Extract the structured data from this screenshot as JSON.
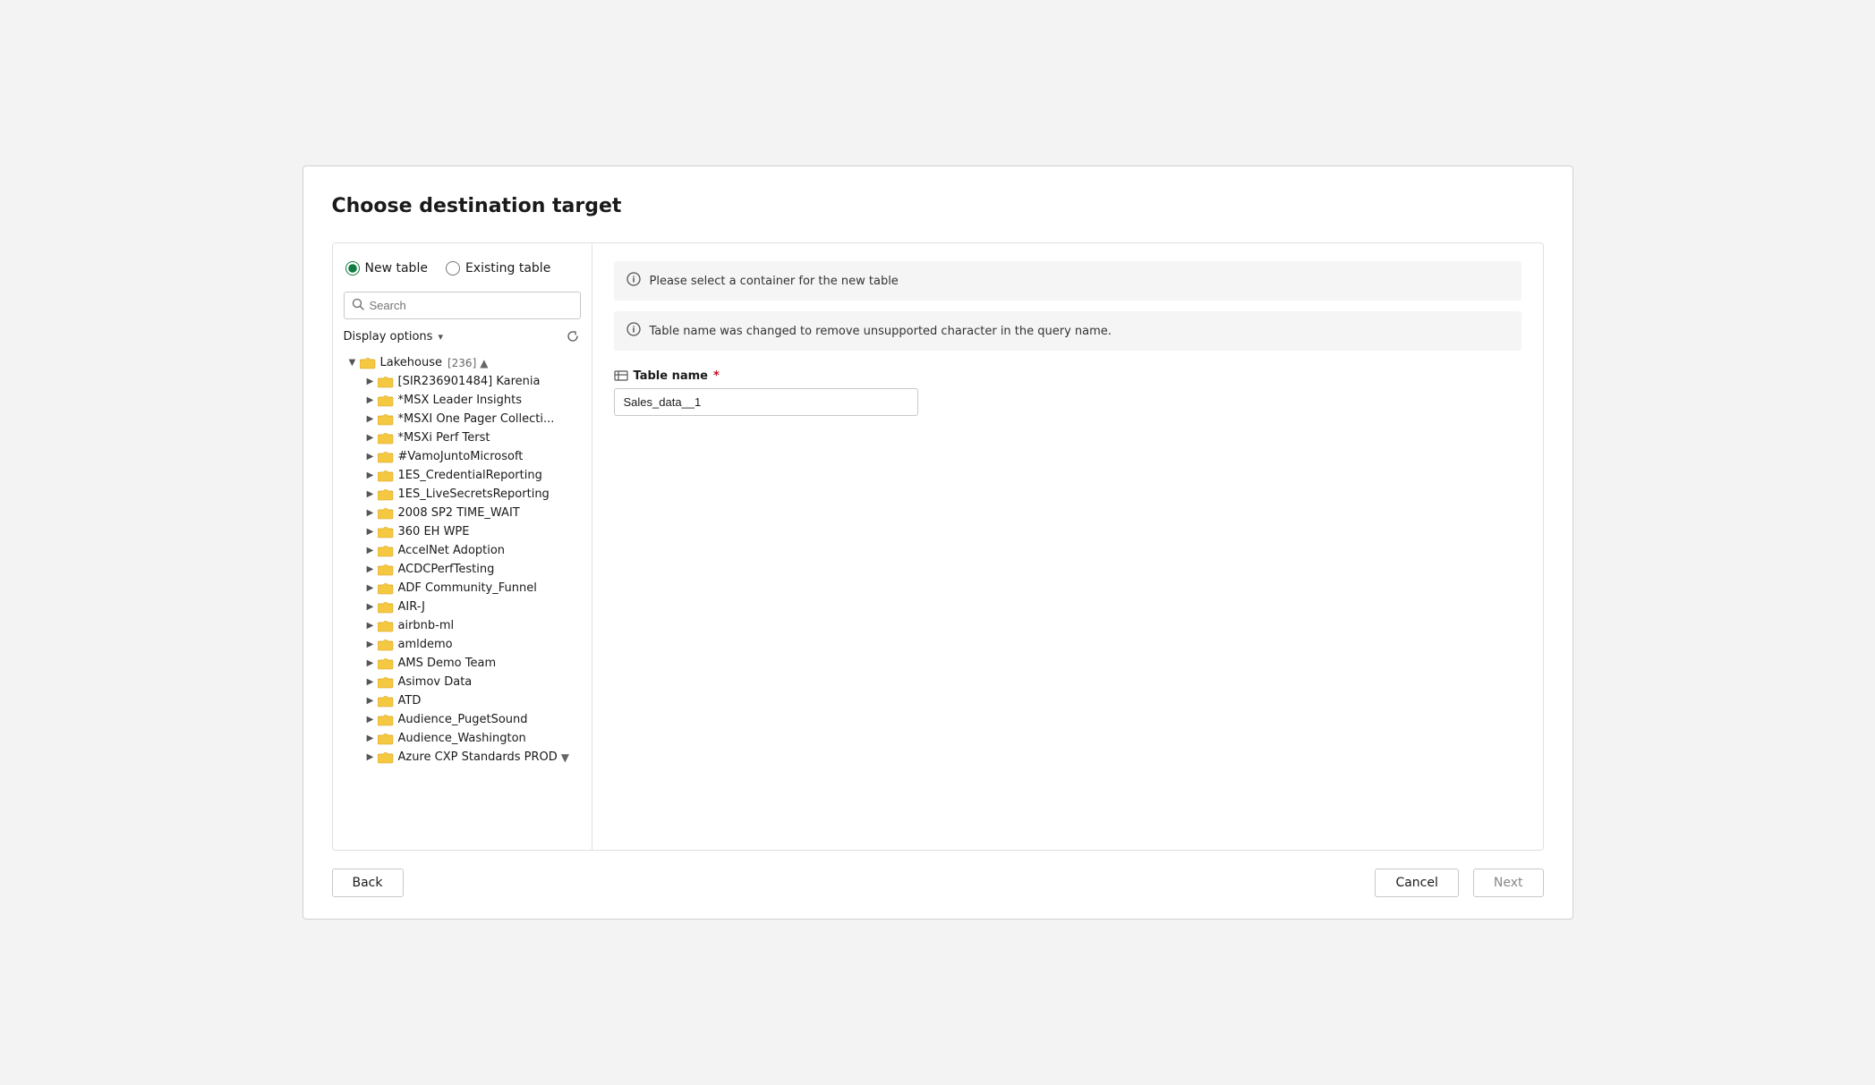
{
  "dialog": {
    "title": "Choose destination target"
  },
  "radio_group": {
    "new_table_label": "New table",
    "existing_table_label": "Existing table",
    "selected": "new"
  },
  "search": {
    "placeholder": "Search"
  },
  "display_options": {
    "label": "Display options",
    "chevron": "▾"
  },
  "tree": {
    "root": {
      "label": "Lakehouse",
      "count": "[236]"
    },
    "children": [
      "[SIR236901484] Karenia",
      "*MSX Leader Insights",
      "*MSXI One Pager Collecti...",
      "*MSXi Perf Terst",
      "#VamoJuntoMicrosoft",
      "1ES_CredentialReporting",
      "1ES_LiveSecretsReporting",
      "2008 SP2 TIME_WAIT",
      "360 EH WPE",
      "AccelNet Adoption",
      "ACDCPerfTesting",
      "ADF Community_Funnel",
      "AIR-J",
      "airbnb-ml",
      "amldemo",
      "AMS Demo Team",
      "Asimov Data",
      "ATD",
      "Audience_PugetSound",
      "Audience_Washington",
      "Azure CXP Standards PROD"
    ]
  },
  "right_panel": {
    "info_message": "Please select a container for the new table",
    "warning_message": "Table name was changed to remove unsupported character in the query name.",
    "table_name_label": "Table name",
    "table_name_value": "Sales_data__1"
  },
  "footer": {
    "back_label": "Back",
    "cancel_label": "Cancel",
    "next_label": "Next"
  }
}
